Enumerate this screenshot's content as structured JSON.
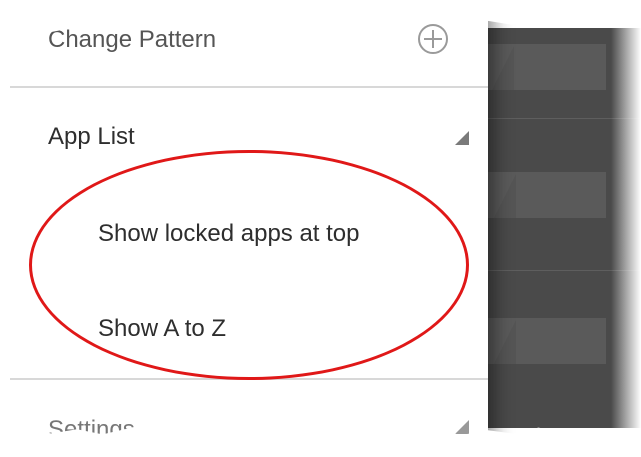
{
  "menu": {
    "change_pattern": "Change Pattern",
    "app_list": "App List",
    "show_locked_top": "Show locked apps at top",
    "show_a_to_z": "Show A to Z",
    "settings": "Settings"
  },
  "icons": {
    "add": "plus-circle-icon",
    "expand": "triangle-expand-icon"
  },
  "colors": {
    "highlight": "#e01818",
    "backdrop": "#4a4a4a",
    "text": "#2e2e2e"
  }
}
